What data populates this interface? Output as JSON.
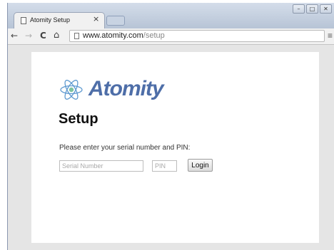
{
  "browser": {
    "tab": {
      "title": "Atomity Setup",
      "close_glyph": "×",
      "icon": "document-icon"
    },
    "window_controls": [
      "minimize",
      "maximize",
      "close"
    ],
    "toolbar": {
      "back_glyph": "←",
      "forward_glyph": "→",
      "reload_glyph": "C",
      "home_glyph": "⌂",
      "menu_glyph": "≡"
    },
    "address": {
      "host": "www.atomity.com",
      "path": "/setup"
    }
  },
  "page": {
    "logo": {
      "text": "Atomity",
      "icon": "atom-icon",
      "color": "#4e6ea8",
      "accent": "#7ec3a0"
    },
    "title": "Setup",
    "prompt": "Please enter your serial number and PIN:",
    "form": {
      "serial_placeholder": "Serial Number",
      "serial_value": "",
      "pin_placeholder": "PIN",
      "pin_value": "",
      "login_label": "Login"
    }
  }
}
